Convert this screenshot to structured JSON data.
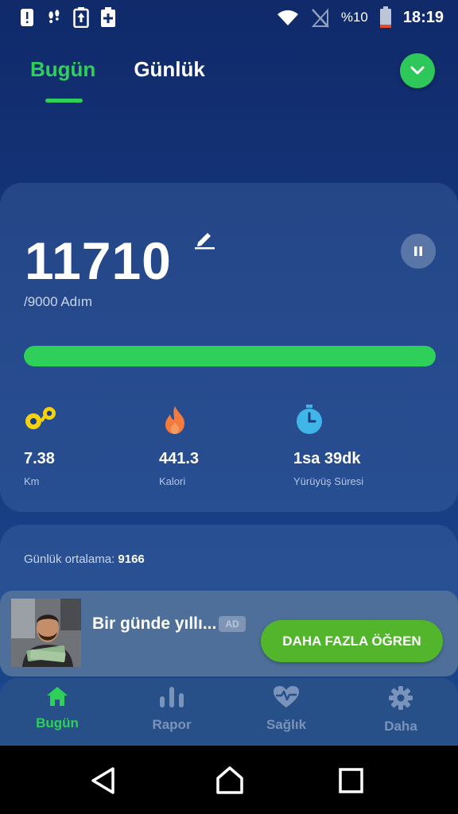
{
  "status_bar": {
    "battery_percent": "%10",
    "time": "18:19"
  },
  "top_tabs": [
    {
      "label": "Bugün",
      "active": true
    },
    {
      "label": "Günlük",
      "active": false
    }
  ],
  "steps": {
    "value": "11710",
    "goal_text": "/9000 Adım",
    "progress_fraction": 1.0
  },
  "stats": [
    {
      "value": "7.38",
      "label": "Km",
      "icon": "footprints-icon",
      "color": "#f5d20f"
    },
    {
      "value": "441.3",
      "label": "Kalori",
      "icon": "flame-icon",
      "color": "#f27b3d"
    },
    {
      "value": "1sa 39dk",
      "label": "Yürüyüş Süresi",
      "icon": "stopwatch-icon",
      "color": "#3fb5e8"
    }
  ],
  "daily_average": {
    "label": "Günlük ortalama:",
    "value": "9166"
  },
  "ad": {
    "title": "Bir günde yıllı...",
    "badge": "AD",
    "cta": "DAHA FAZLA ÖĞREN"
  },
  "bottom_nav": [
    {
      "label": "Bugün",
      "icon": "home-icon",
      "active": true
    },
    {
      "label": "Rapor",
      "icon": "bar-chart-icon",
      "active": false
    },
    {
      "label": "Sağlık",
      "icon": "heart-pulse-icon",
      "active": false
    },
    {
      "label": "Daha",
      "icon": "gear-icon",
      "active": false
    }
  ],
  "colors": {
    "accent_green": "#2fd05a",
    "background": "#16387e",
    "cta_green": "#52b52c"
  }
}
